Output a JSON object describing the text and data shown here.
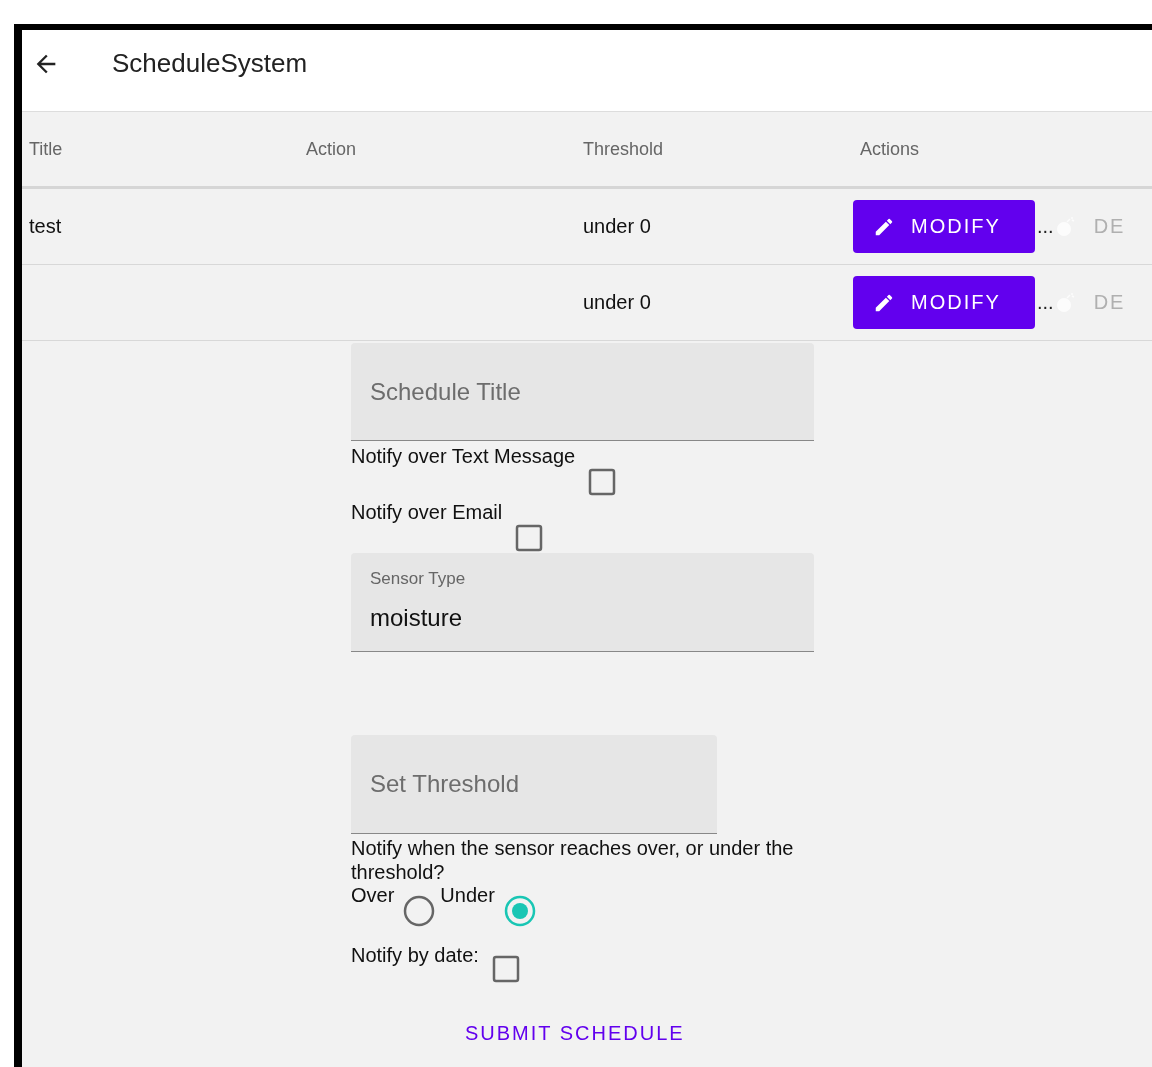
{
  "app_bar": {
    "title": "ScheduleSystem"
  },
  "table": {
    "columns": [
      "Title",
      "Action",
      "Threshold",
      "Actions"
    ],
    "rows": [
      {
        "title": "test",
        "threshold": "under 0",
        "modify": "MODIFY",
        "ellipsis": "...",
        "delete": "DE"
      },
      {
        "threshold": "under 0",
        "modify": "MODIFY",
        "ellipsis": "...",
        "delete": "DE"
      }
    ]
  },
  "form": {
    "title_field": {
      "placeholder": "Schedule Title"
    },
    "checkboxes": [
      {
        "label": "Notify over Text Message",
        "checked": false
      },
      {
        "label": "Notify over Email",
        "checked": false
      }
    ],
    "sensor_type": {
      "label": "Sensor Type",
      "value": "moisture"
    },
    "threshold_field": {
      "placeholder": "Set Threshold"
    },
    "question": "Notify when the sensor reaches over, or under the threshold?",
    "radios": [
      {
        "label": "Over",
        "selected": false
      },
      {
        "label": "Under",
        "selected": true
      }
    ],
    "date_checkbox": {
      "label": "Notify by date:",
      "checked": false
    },
    "submit": "SUBMIT SCHEDULE"
  }
}
